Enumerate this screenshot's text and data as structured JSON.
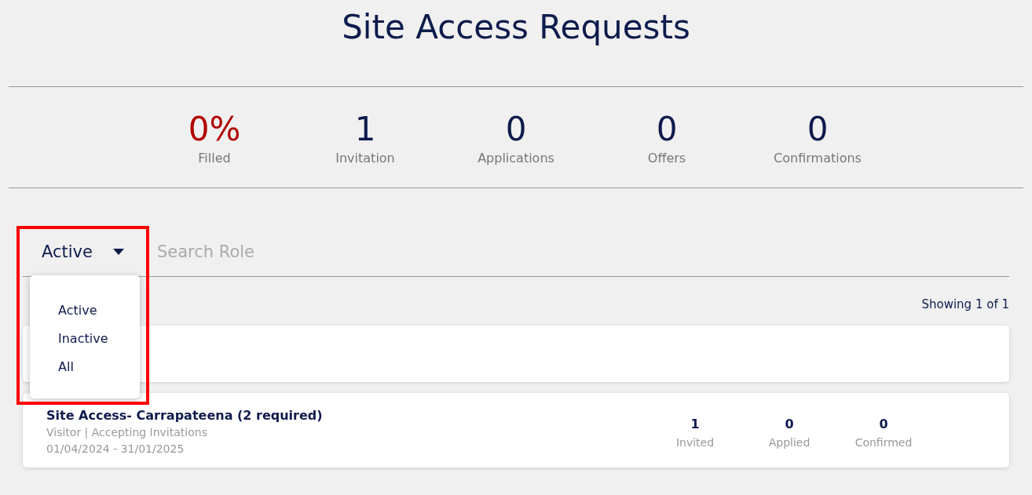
{
  "title": "Site Access Requests",
  "stats": [
    {
      "value": "0%",
      "label": "Filled",
      "color": "#b00000"
    },
    {
      "value": "1",
      "label": "Invitation",
      "color": "#0d1b4c"
    },
    {
      "value": "0",
      "label": "Applications",
      "color": "#0d1b4c"
    },
    {
      "value": "0",
      "label": "Offers",
      "color": "#0d1b4c"
    },
    {
      "value": "0",
      "label": "Confirmations",
      "color": "#0d1b4c"
    }
  ],
  "filter": {
    "value": "Active",
    "expanded": true,
    "options": [
      "Active",
      "Inactive",
      "All"
    ]
  },
  "search": {
    "placeholder": "Search Role"
  },
  "showing": "Showing 1 of 1",
  "requests": [
    {
      "title": "Site Access- Carrapateena (2 required)",
      "meta": "Visitor | Accepting Invitations",
      "dates": "01/04/2024 - 31/01/2025",
      "counts": [
        {
          "value": "1",
          "label": "Invited"
        },
        {
          "value": "0",
          "label": "Applied"
        },
        {
          "value": "0",
          "label": "Confirmed"
        }
      ]
    }
  ]
}
